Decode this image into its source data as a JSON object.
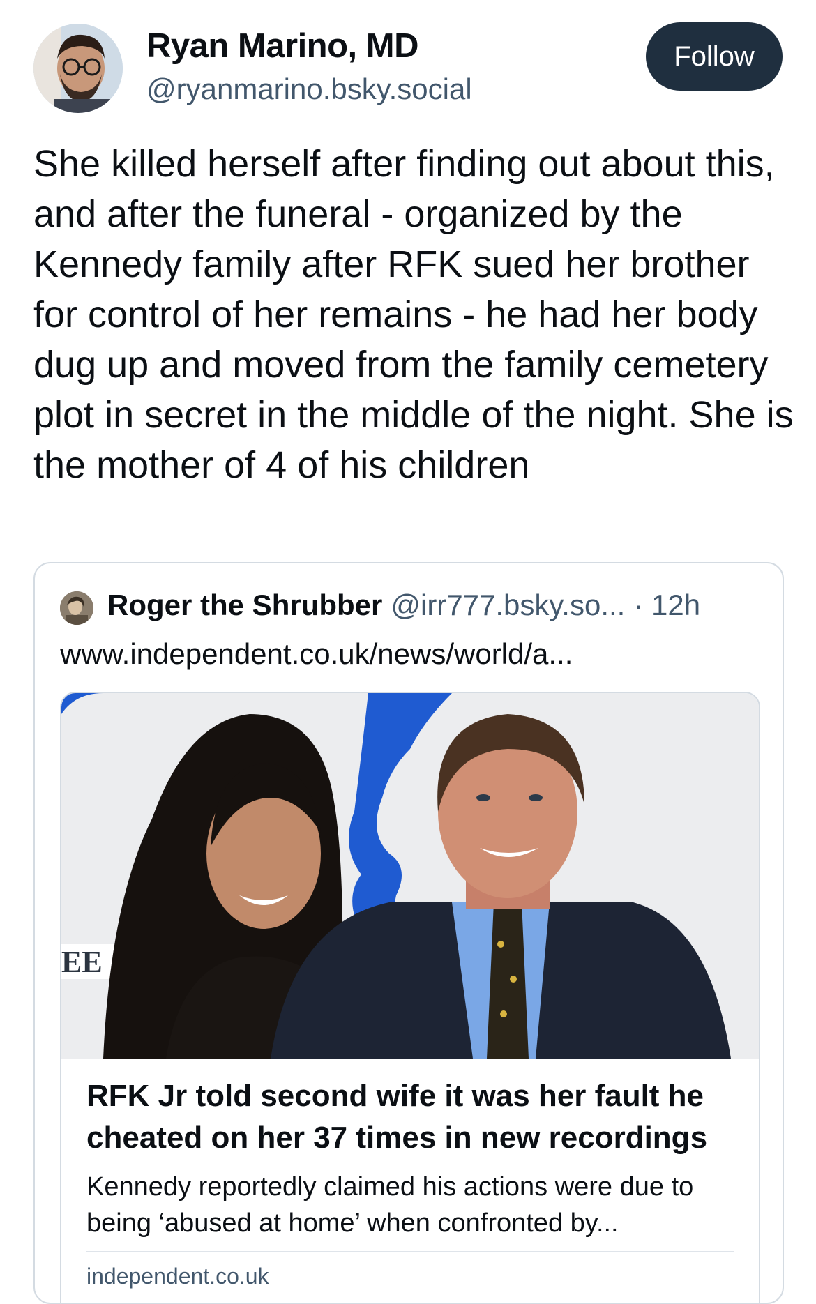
{
  "author": {
    "name": "Ryan Marino, MD",
    "handle": "@ryanmarino.bsky.social",
    "follow_label": "Follow"
  },
  "post": {
    "text": "She killed herself after finding out about this, and after the funeral - organized by the Kennedy family after RFK sued her brother for control of her remains - he had her body dug up and moved from the family cemetery plot in secret in the middle of the night. She is the mother of 4 of his children"
  },
  "quote": {
    "author_name": "Roger the Shrubber",
    "author_handle": "@irr777.bsky.so...",
    "timestamp": "· 12h",
    "link_text": "www.independent.co.uk/news/world/a...",
    "embed": {
      "title": "RFK Jr told second wife it was her fault he cheated on her 37 times in new recordings",
      "description": "Kennedy reportedly claimed his actions were due to being ‘abused at home’ when confronted by...",
      "domain": "independent.co.uk"
    }
  },
  "colors": {
    "follow_bg": "#1f2f3f",
    "handle_text": "#42576c",
    "card_border": "#d4dbe2"
  },
  "icons": {
    "author_avatar": "profile-photo",
    "quote_avatar": "profile-photo"
  }
}
